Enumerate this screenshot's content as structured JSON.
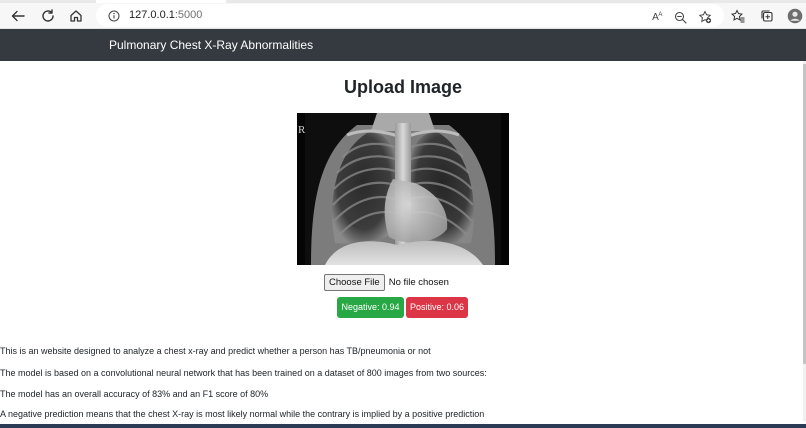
{
  "browser": {
    "url_host": "127.0.0.1",
    "url_port": ":5000",
    "read_aloud_label": "A",
    "read_aloud_superscript": "A"
  },
  "navbar": {
    "brand": "Pulmonary Chest X-Ray Abnormalities"
  },
  "main": {
    "title": "Upload Image",
    "xray_marker": "R",
    "upload": {
      "button_label": "Choose File",
      "status": "No file chosen"
    },
    "prediction": {
      "negative": "Negative: 0.94",
      "positive": "Positive: 0.06"
    },
    "description": [
      "This is an website designed to analyze a chest x-ray and predict whether a person has TB/pneumonia or not",
      "The model is based on a convolutional neural network that has been trained on a dataset of 800 images from two sources:",
      "The model has an overall accuracy of 83% and an F1 score of 80%",
      "A negative prediction means that the chest X-ray is most likely normal while the contrary is implied by a positive prediction"
    ]
  },
  "colors": {
    "navbar_bg": "#343a40",
    "negative_badge": "#28a745",
    "positive_badge": "#dc3545"
  },
  "icons": {
    "back": "back-arrow-icon",
    "reload": "reload-icon",
    "home": "home-icon",
    "site_info": "info-icon",
    "read_aloud": "read-aloud-icon",
    "zoom": "zoom-out-icon",
    "favorite": "add-favorite-icon",
    "favorites": "favorites-icon",
    "collections": "collections-icon",
    "profile": "profile-icon"
  }
}
